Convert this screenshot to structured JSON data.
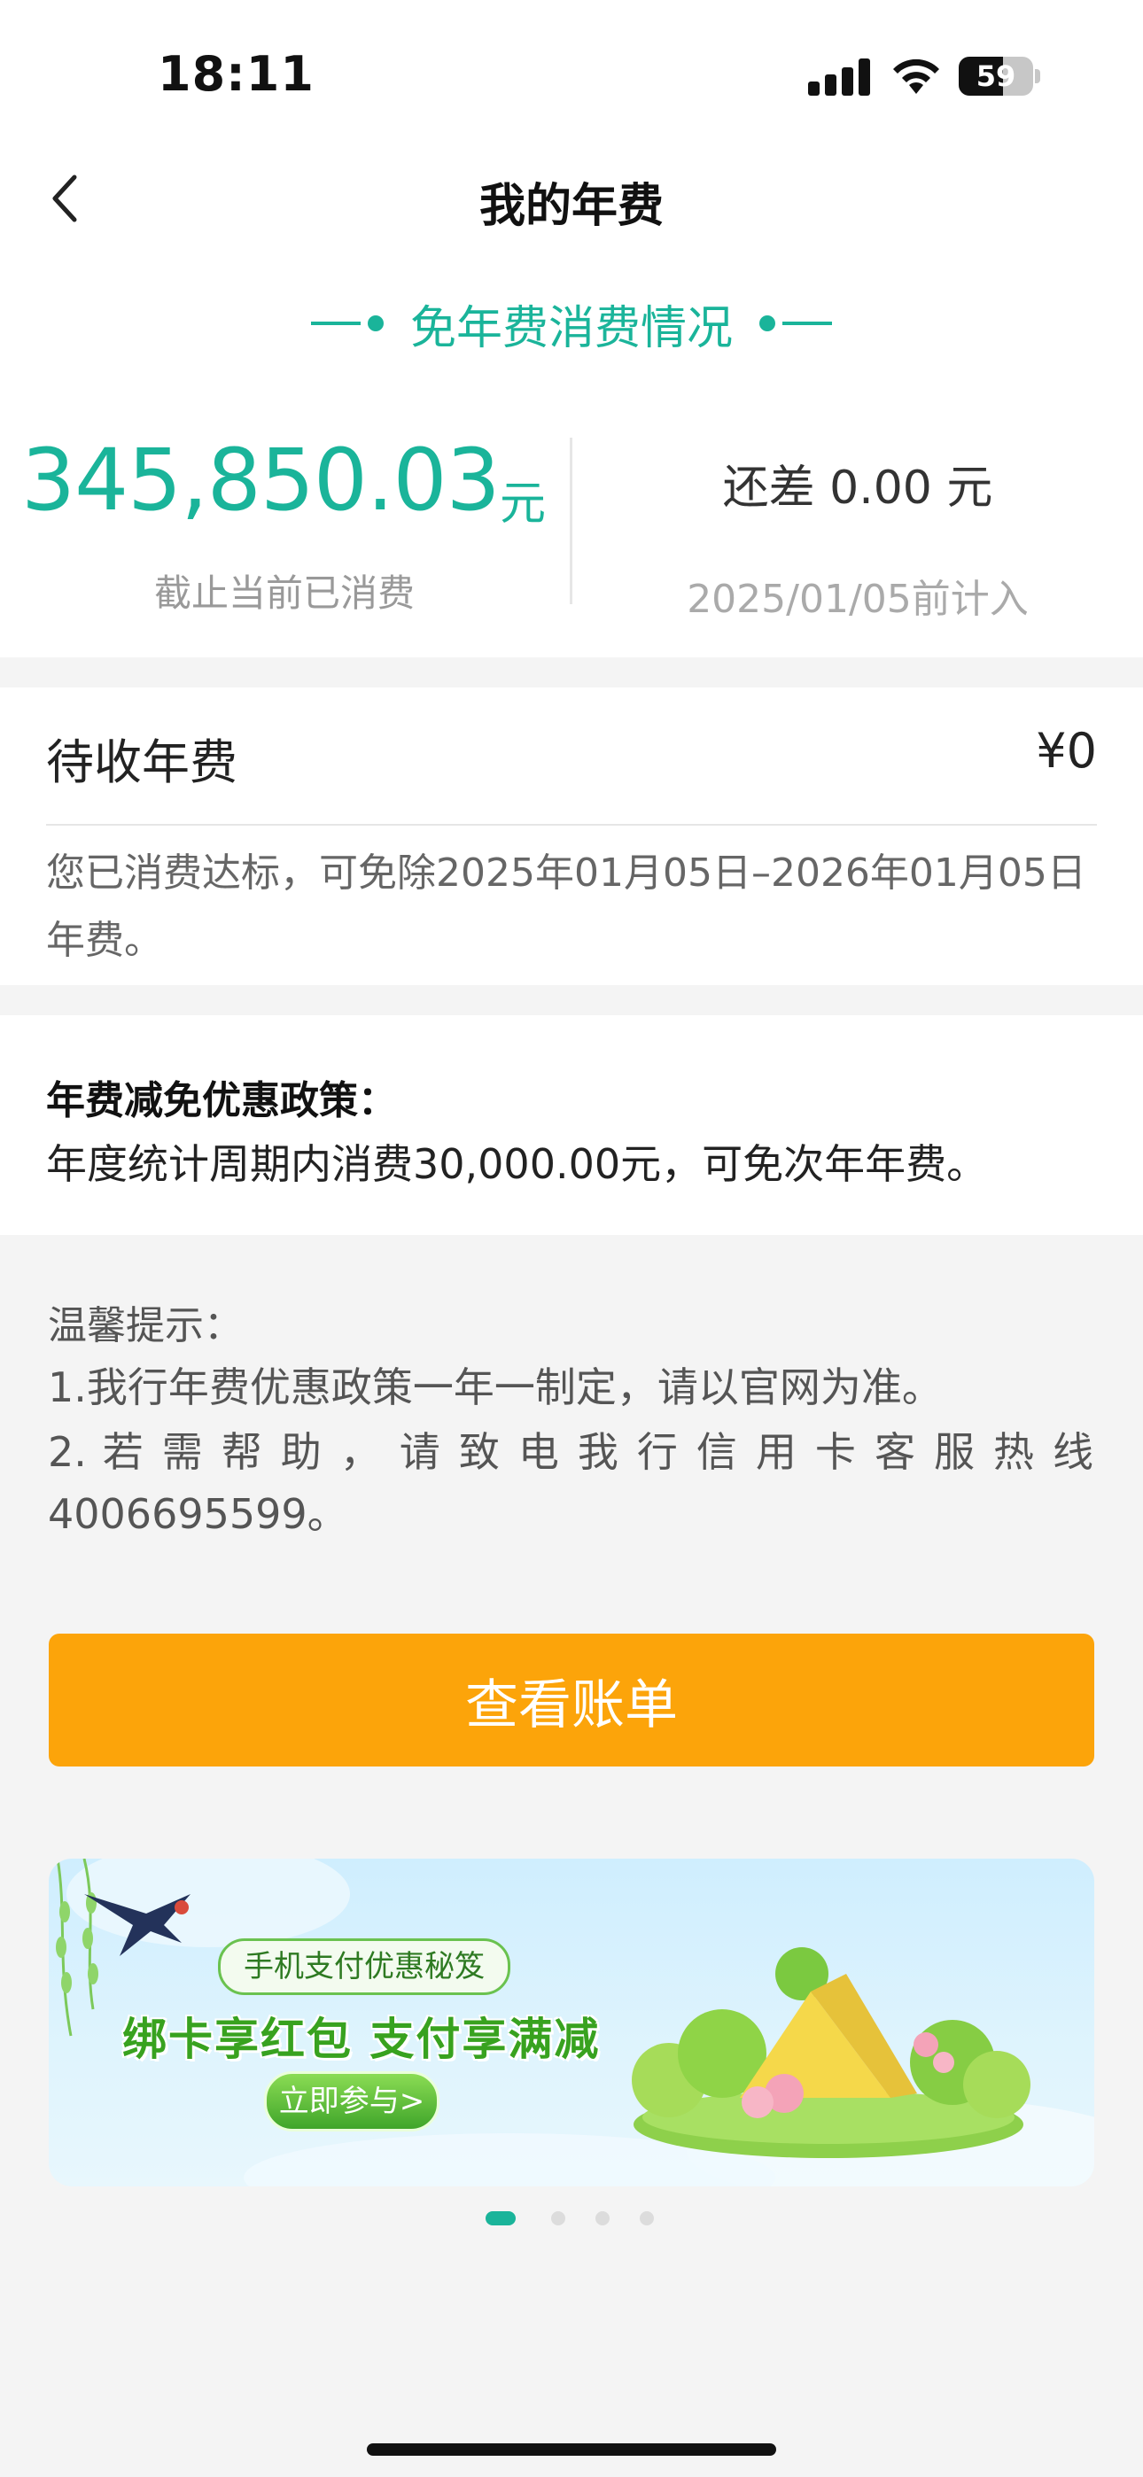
{
  "status_bar": {
    "time": "18:11",
    "battery": "59"
  },
  "nav": {
    "title": "我的年费"
  },
  "summary": {
    "section_title": "免年费消费情况",
    "spent_amount": "345,850.03",
    "spent_unit": "元",
    "spent_label": "截止当前已消费",
    "remaining_text": "还差 0.00 元",
    "remaining_date": "2025/01/05前计入"
  },
  "pending_fee": {
    "label": "待收年费",
    "value": "¥0",
    "note": "您已消费达标，可免除2025年01月05日–2026年01月05日年费。"
  },
  "policy": {
    "title": "年费减免优惠政策：",
    "text": "年度统计周期内消费30,000.00元，可免次年年费。"
  },
  "tips": {
    "title": "温馨提示：",
    "items": [
      "1.我行年费优惠政策一年一制定，请以官网为准。",
      "2. 若 需 帮 助 ， 请 致 电 我 行 信 用 卡 客 服 热 线 4006695599。"
    ]
  },
  "button": {
    "label": "查看账单"
  },
  "banner": {
    "pill": "手机支付优惠秘笈",
    "headline": "绑卡享红包 支付享满减",
    "cta": "立即参与>"
  },
  "carousel": {
    "total": 4,
    "active": 1
  },
  "colors": {
    "accent": "#1ab49a",
    "button": "#fca40a"
  }
}
